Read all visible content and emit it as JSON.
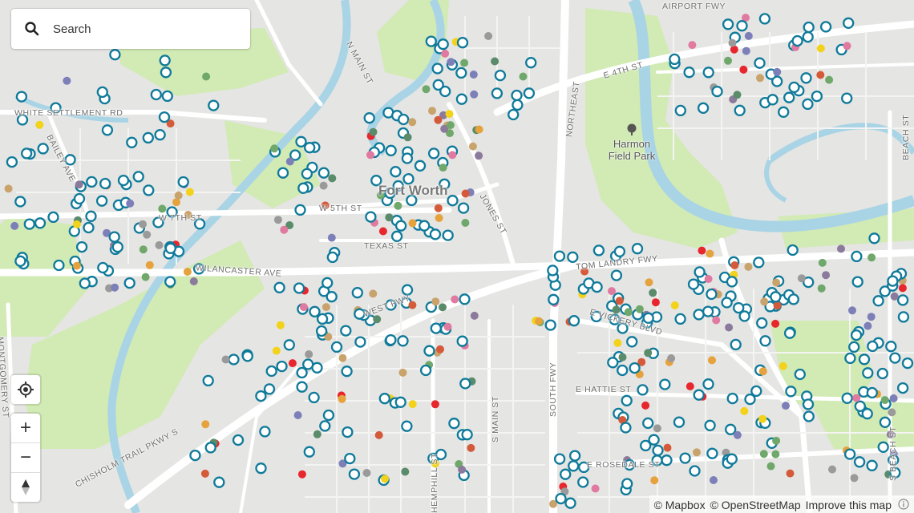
{
  "search": {
    "placeholder": "Search"
  },
  "map": {
    "city_label": "Fort Worth",
    "park_label_line1": "Harmon",
    "park_label_line2": "Field Park",
    "street_labels": [
      "AIRPORT FWY",
      "N MAIN ST",
      "E 4TH ST",
      "WHITE SETTLEMENT RD",
      "BAILEY AVE",
      "NORTHEAST",
      "W 7TH ST",
      "W 5TH ST",
      "TEXAS ST",
      "JONES ST",
      "BEACH ST",
      "WILANCASTER AVE",
      "TOM LANDRY FWY",
      "WEST FWY",
      "E VICKERY BLVD",
      "SOUTH FWY",
      "E HATTIE ST",
      "MONTGOMERY ST",
      "S MAIN ST",
      "CHISHOLM TRAIL PKWY S",
      "HEMPHILL ST",
      "E ROSEDALE ST",
      "S BEACH ST"
    ]
  },
  "controls": {
    "zoom_in": "+",
    "zoom_out": "−"
  },
  "attribution": {
    "mapbox": "© Mapbox",
    "osm": "© OpenStreetMap",
    "improve": "Improve this map"
  },
  "colors": {
    "land": "#e5e5e3",
    "water": "#a8d4e6",
    "park": "#d2eab4",
    "road": "#ffffff",
    "marker_ring": "#0f7a9a",
    "marker_fills": [
      "#e8262e",
      "#5a8b6a",
      "#7d7fb8",
      "#f2d21a",
      "#e6a23c",
      "#c9a36c",
      "#8b7a9b",
      "#9a9a9a",
      "#e07aa0",
      "#6fa86a",
      "#d45a3a"
    ]
  }
}
